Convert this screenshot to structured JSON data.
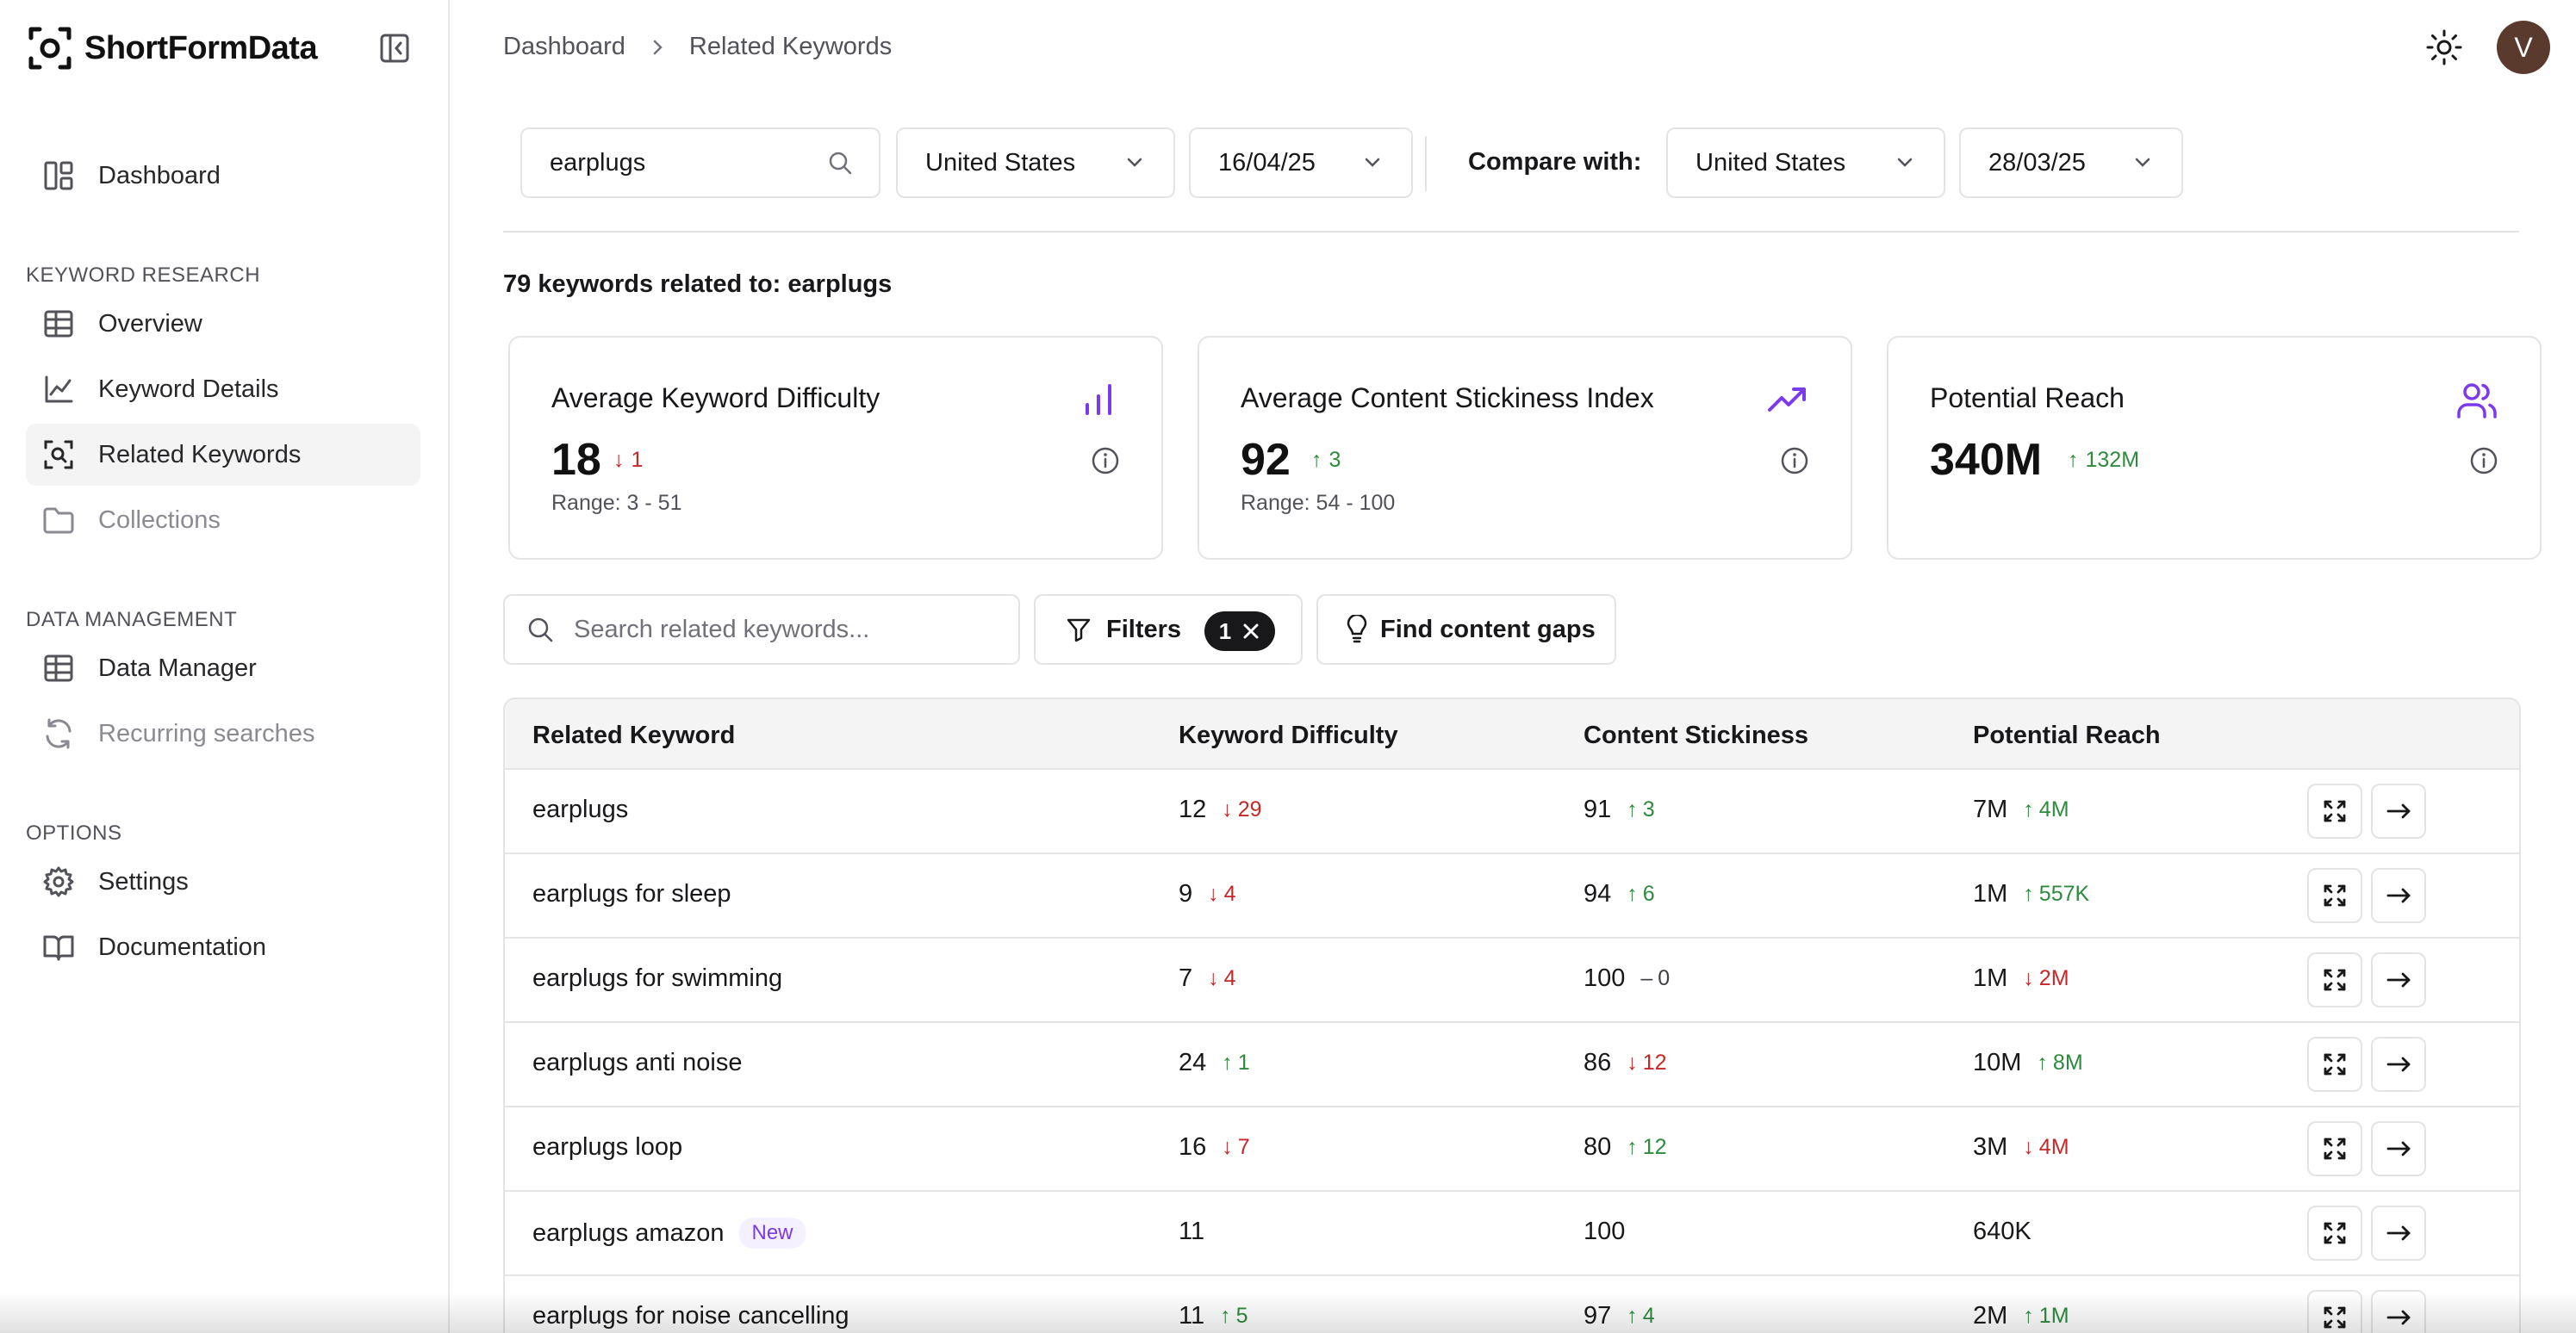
{
  "app": {
    "name": "ShortFormData"
  },
  "sidebar": {
    "dashboard": "Dashboard",
    "sections": [
      {
        "title": "KEYWORD RESEARCH",
        "items": [
          "Overview",
          "Keyword Details",
          "Related Keywords",
          "Collections"
        ]
      },
      {
        "title": "DATA MANAGEMENT",
        "items": [
          "Data Manager",
          "Recurring searches"
        ]
      },
      {
        "title": "OPTIONS",
        "items": [
          "Settings",
          "Documentation"
        ]
      }
    ],
    "active_item": "Related Keywords"
  },
  "breadcrumb": [
    "Dashboard",
    "Related Keywords"
  ],
  "user": {
    "initial": "V"
  },
  "search": {
    "keyword": "earplugs",
    "country": "United States",
    "date": "16/04/25",
    "compare_label": "Compare with:",
    "compare_country": "United States",
    "compare_date": "28/03/25"
  },
  "summary": {
    "text": "79 keywords related to: earplugs"
  },
  "cards": [
    {
      "title": "Average Keyword Difficulty",
      "value": "18",
      "change": "1",
      "direction": "down",
      "range": "Range: 3 - 51",
      "icon": "bar-chart-icon"
    },
    {
      "title": "Average Content Stickiness Index",
      "value": "92",
      "change": "3",
      "direction": "up",
      "range": "Range: 54 - 100",
      "icon": "trending-up-icon"
    },
    {
      "title": "Potential Reach",
      "value": "340M",
      "change": "132M",
      "direction": "up",
      "range": "",
      "icon": "users-icon"
    }
  ],
  "filters": {
    "search_placeholder": "Search related keywords...",
    "filters_label": "Filters",
    "filter_count": "1",
    "content_gaps_label": "Find content gaps"
  },
  "table": {
    "columns": [
      "Related Keyword",
      "Keyword Difficulty",
      "Content Stickiness",
      "Potential Reach"
    ],
    "rows": [
      {
        "keyword": "earplugs",
        "badge": "",
        "kd": "12",
        "kd_chg": "29",
        "kd_dir": "down",
        "cs": "91",
        "cs_chg": "3",
        "cs_dir": "up",
        "reach": "7M",
        "reach_chg": "4M",
        "reach_dir": "up"
      },
      {
        "keyword": "earplugs for sleep",
        "badge": "",
        "kd": "9",
        "kd_chg": "4",
        "kd_dir": "down",
        "cs": "94",
        "cs_chg": "6",
        "cs_dir": "up",
        "reach": "1M",
        "reach_chg": "557K",
        "reach_dir": "up"
      },
      {
        "keyword": "earplugs for swimming",
        "badge": "",
        "kd": "7",
        "kd_chg": "4",
        "kd_dir": "down",
        "cs": "100",
        "cs_chg": "0",
        "cs_dir": "neutral",
        "reach": "1M",
        "reach_chg": "2M",
        "reach_dir": "down"
      },
      {
        "keyword": "earplugs anti noise",
        "badge": "",
        "kd": "24",
        "kd_chg": "1",
        "kd_dir": "up",
        "cs": "86",
        "cs_chg": "12",
        "cs_dir": "down",
        "reach": "10M",
        "reach_chg": "8M",
        "reach_dir": "up"
      },
      {
        "keyword": "earplugs loop",
        "badge": "",
        "kd": "16",
        "kd_chg": "7",
        "kd_dir": "down",
        "cs": "80",
        "cs_chg": "12",
        "cs_dir": "up",
        "reach": "3M",
        "reach_chg": "4M",
        "reach_dir": "down"
      },
      {
        "keyword": "earplugs amazon",
        "badge": "New",
        "kd": "11",
        "kd_chg": "",
        "kd_dir": "",
        "cs": "100",
        "cs_chg": "",
        "cs_dir": "",
        "reach": "640K",
        "reach_chg": "",
        "reach_dir": ""
      },
      {
        "keyword": "earplugs for noise cancelling",
        "badge": "",
        "kd": "11",
        "kd_chg": "5",
        "kd_dir": "up",
        "cs": "97",
        "cs_chg": "4",
        "cs_dir": "up",
        "reach": "2M",
        "reach_chg": "1M",
        "reach_dir": "up"
      }
    ]
  },
  "colors": {
    "accent_purple": "#7c3aed",
    "up": "#2e8b3e",
    "down": "#c62828"
  }
}
